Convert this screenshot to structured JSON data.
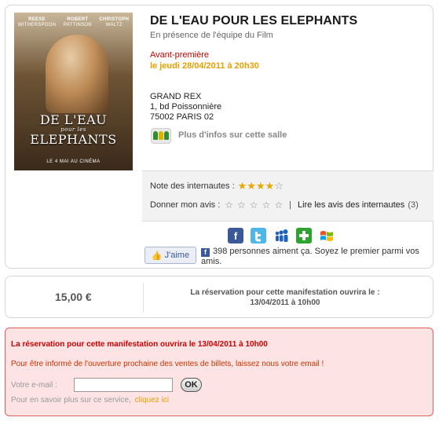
{
  "event": {
    "title": "DE L'EAU POUR LES ELEPHANTS",
    "subtitle": "En présence de l'équipe du Film",
    "preview": "Avant-première",
    "date": "le jeudi 28/04/2011 à 20h30",
    "venue": [
      "GRAND REX",
      "1, bd Poissonnière",
      "75002 PARIS 02"
    ],
    "more_info": "Plus d'infos sur cette salle",
    "poster": {
      "names": [
        {
          "first": "REESE",
          "last": "WITHERSPOON"
        },
        {
          "first": "ROBERT",
          "last": "PATTINSON"
        },
        {
          "first": "CHRISTOPH",
          "last": "WALTZ"
        }
      ],
      "title_top": "DE L'EAU",
      "title_small": "pour les",
      "title_bottom": "ELEPHANTS",
      "release": "LE 4 MAI AU CINÉMA"
    }
  },
  "rating": {
    "label": "Note des internautes :",
    "value": 4,
    "max": 5,
    "give_opinion": "Donner mon avis :",
    "separator": "|",
    "read_reviews": "Lire les avis des internautes",
    "review_count": "(3)"
  },
  "social": {
    "icons": [
      "facebook-icon",
      "twitter-icon",
      "myspace-icon",
      "plus-icon",
      "windows-live-icon"
    ],
    "like_label": "J'aime",
    "like_text": "398 personnes aiment ça. Soyez le premier parmi vos amis."
  },
  "pricing": {
    "price": "15,00 €",
    "booking_note_line1": "La réservation pour cette manifestation ouvrira le :",
    "booking_note_line2": "13/04/2011 à 10h00"
  },
  "alert": {
    "title": "La réservation pour cette manifestation ouvrira le 13/04/2011 à 10h00",
    "info": "Pour être informé de l'ouverture prochaine des ventes de billets, laissez nous votre email !",
    "email_label": "Votre e-mail :",
    "email_value": "",
    "ok_label": "OK",
    "learn_more": "Pour en savoir plus sur ce service,",
    "learn_link": "cliquez ici"
  },
  "colors": {
    "title_red": "#cc0000",
    "date_orange": "#e8a000",
    "alert_bg": "#fde3e3",
    "alert_border": "#e06060",
    "facebook": "#3b5998"
  }
}
